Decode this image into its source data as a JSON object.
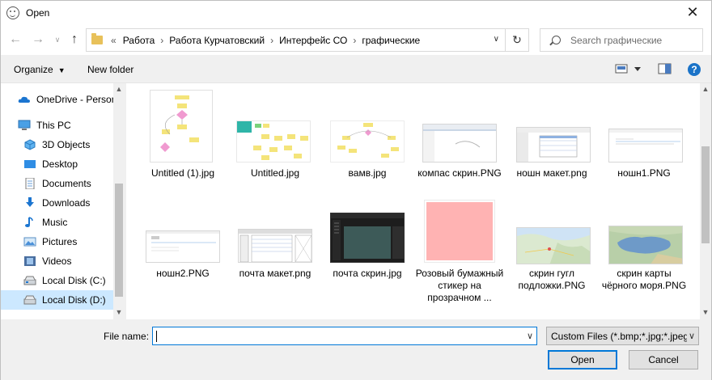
{
  "window": {
    "title": "Open"
  },
  "address": {
    "crumbs": [
      "Работа",
      "Работа Курчатовский",
      "Интерфейс СО",
      "графические"
    ]
  },
  "search": {
    "placeholder": "Search графические"
  },
  "toolbar": {
    "organize": "Organize",
    "new_folder": "New folder"
  },
  "nav": {
    "items": [
      {
        "label": "OneDrive - Person",
        "icon": "onedrive-cloud-icon"
      },
      {
        "label": "This PC",
        "icon": "computer-icon"
      },
      {
        "label": "3D Objects",
        "icon": "3d-objects-icon"
      },
      {
        "label": "Desktop",
        "icon": "desktop-icon"
      },
      {
        "label": "Documents",
        "icon": "documents-icon"
      },
      {
        "label": "Downloads",
        "icon": "download-arrow-icon"
      },
      {
        "label": "Music",
        "icon": "music-note-icon"
      },
      {
        "label": "Pictures",
        "icon": "pictures-icon"
      },
      {
        "label": "Videos",
        "icon": "videos-icon"
      },
      {
        "label": "Local Disk (C:)",
        "icon": "drive-icon"
      },
      {
        "label": "Local Disk (D:)",
        "icon": "drive-icon"
      }
    ],
    "selected": "Local Disk (D:)"
  },
  "files": [
    {
      "name": "Untitled (1).jpg"
    },
    {
      "name": "Untitled.jpg"
    },
    {
      "name": "вамв.jpg"
    },
    {
      "name": "компас скрин.PNG"
    },
    {
      "name": "ношн макет.png"
    },
    {
      "name": "ношн1.PNG"
    },
    {
      "name": "ношн2.PNG"
    },
    {
      "name": "почта макет.png"
    },
    {
      "name": "почта скрин.jpg"
    },
    {
      "name": "Розовый бумажный стикер на прозрачном ..."
    },
    {
      "name": "скрин гугл подложки.PNG"
    },
    {
      "name": "скрин карты чёрного моря.PNG"
    }
  ],
  "bottom": {
    "file_name_label": "File name:",
    "file_name_value": "",
    "filter": "Custom Files (*.bmp;*.jpg;*.jpeg",
    "open": "Open",
    "cancel": "Cancel"
  }
}
